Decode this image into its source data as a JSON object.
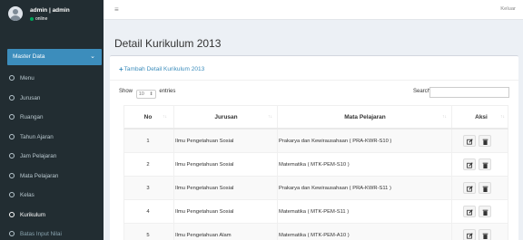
{
  "user": {
    "name": "admin | admin",
    "status": "online"
  },
  "sidebar": {
    "header": "Master Data",
    "items": [
      {
        "label": "Menu"
      },
      {
        "label": "Jurusan"
      },
      {
        "label": "Ruangan"
      },
      {
        "label": "Tahun Ajaran"
      },
      {
        "label": "Jam Pelajaran"
      },
      {
        "label": "Mata Pelajaran"
      },
      {
        "label": "Kelas"
      },
      {
        "label": "Kurikulum"
      },
      {
        "label": "Batas Input Nilai"
      }
    ]
  },
  "topbar": {
    "logout": "Keluar"
  },
  "page": {
    "title": "Detail Kurikulum 2013",
    "add_label": "Tambah Detail Kurikulum 2013"
  },
  "table_controls": {
    "show": "Show",
    "entries_value": "10",
    "entries": "entries",
    "search": "Search:"
  },
  "table": {
    "headers": {
      "no": "No",
      "jurusan": "Jurusan",
      "mapel": "Mata Pelajaran",
      "aksi": "Aksi"
    },
    "rows": [
      {
        "no": "1",
        "jurusan": "Ilmu Pengetahuan Sosial",
        "mapel": "Prakarya dan Kewirausahaan ( PRA-KWR-S10 )"
      },
      {
        "no": "2",
        "jurusan": "Ilmu Pengetahuan Sosial",
        "mapel": "Matematika ( MTK-PEM-S10 )"
      },
      {
        "no": "3",
        "jurusan": "Ilmu Pengetahuan Sosial",
        "mapel": "Prakarya dan Kewirausahaan ( PRA-KWR-S11 )"
      },
      {
        "no": "4",
        "jurusan": "Ilmu Pengetahuan Sosial",
        "mapel": "Matematika ( MTK-PEM-S11 )"
      },
      {
        "no": "5",
        "jurusan": "Ilmu Pengetahuan Alam",
        "mapel": "Matematika ( MTK-PEM-A10 )"
      }
    ]
  },
  "colors": {
    "sidebar": "#222d32",
    "accent": "#3c8dbc",
    "online": "#00a65a"
  }
}
